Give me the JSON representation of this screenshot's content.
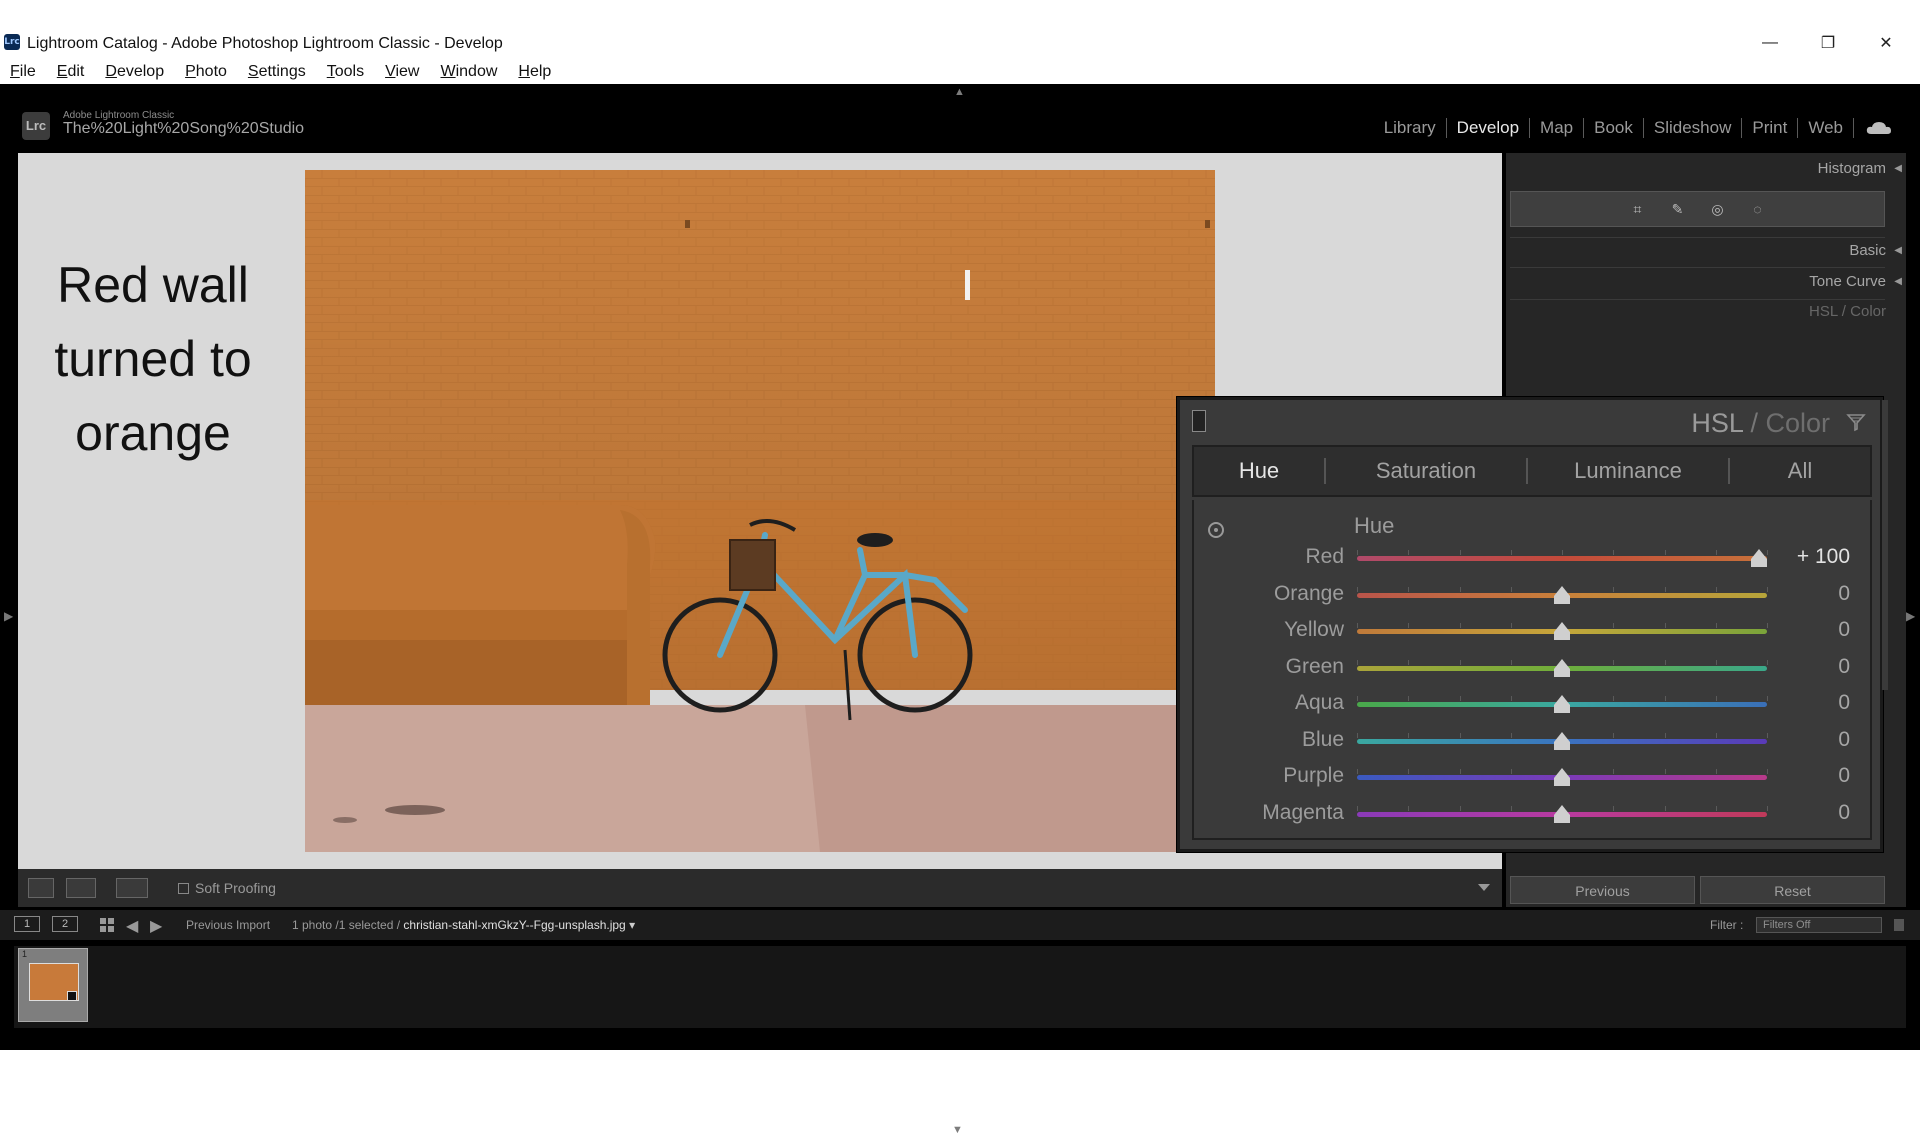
{
  "window": {
    "app_badge": "Lrc",
    "title": "Lightroom Catalog - Adobe Photoshop Lightroom Classic - Develop",
    "minimize": "—",
    "restore": "❐",
    "close": "✕"
  },
  "menubar": [
    {
      "label": "File",
      "accel": "F",
      "rest": "ile"
    },
    {
      "label": "Edit",
      "accel": "E",
      "rest": "dit"
    },
    {
      "label": "Develop",
      "accel": "D",
      "rest": "evelop"
    },
    {
      "label": "Photo",
      "accel": "P",
      "rest": "hoto"
    },
    {
      "label": "Settings",
      "accel": "S",
      "rest": "ettings"
    },
    {
      "label": "Tools",
      "accel": "T",
      "rest": "ools"
    },
    {
      "label": "View",
      "accel": "V",
      "rest": "iew"
    },
    {
      "label": "Window",
      "accel": "W",
      "rest": "indow"
    },
    {
      "label": "Help",
      "accel": "H",
      "rest": "elp"
    }
  ],
  "identity": {
    "logo": "Lrc",
    "app_name": "Adobe Lightroom Classic",
    "catalog": "The%20Light%20Song%20Studio"
  },
  "modules": {
    "items": [
      "Library",
      "Develop",
      "Map",
      "Book",
      "Slideshow",
      "Print",
      "Web"
    ],
    "active": "Develop"
  },
  "annotation": {
    "line1": "Red wall",
    "line2": "turned to",
    "line3": "orange"
  },
  "toolbar": {
    "soft_proofing": "Soft Proofing"
  },
  "right_panel": {
    "histogram": "Histogram",
    "basic": "Basic",
    "tone_curve": "Tone Curve",
    "hsl_partial": "HSL / Color",
    "previous": "Previous",
    "reset": "Reset"
  },
  "hsl": {
    "title_hsl": "HSL",
    "title_sep": " / ",
    "title_color": "Color",
    "tabs": [
      "Hue",
      "Saturation",
      "Luminance",
      "All"
    ],
    "active_tab": "Hue",
    "section": "Hue",
    "sliders": [
      {
        "name": "Red",
        "value_text": "+ 100",
        "value": 100,
        "colors": [
          "#b04a6a",
          "#c44a3a",
          "#c7713a"
        ]
      },
      {
        "name": "Orange",
        "value_text": "0",
        "value": 0,
        "colors": [
          "#b9544a",
          "#c9803a",
          "#b6a43a"
        ]
      },
      {
        "name": "Yellow",
        "value_text": "0",
        "value": 0,
        "colors": [
          "#c07a3a",
          "#c6a63a",
          "#7aa43a"
        ]
      },
      {
        "name": "Green",
        "value_text": "0",
        "value": 0,
        "colors": [
          "#aaa43a",
          "#6fae3a",
          "#3aa88a"
        ]
      },
      {
        "name": "Aqua",
        "value_text": "0",
        "value": 0,
        "colors": [
          "#4aa84a",
          "#3aa8a0",
          "#3a6fb8"
        ]
      },
      {
        "name": "Blue",
        "value_text": "0",
        "value": 0,
        "colors": [
          "#3aa8a0",
          "#3a74c0",
          "#5a3ab8"
        ]
      },
      {
        "name": "Purple",
        "value_text": "0",
        "value": 0,
        "colors": [
          "#3a5ac0",
          "#7a3ab8",
          "#b83a8a"
        ]
      },
      {
        "name": "Magenta",
        "value_text": "0",
        "value": 0,
        "colors": [
          "#8a3ab8",
          "#b83aa0",
          "#c03a5a"
        ]
      }
    ],
    "range": [
      -100,
      100
    ]
  },
  "filmstrip_header": {
    "screen1": "1",
    "screen2": "2",
    "source": "Previous Import",
    "count": "1 photo /1 selected /",
    "filename": "christian-stahl-xmGkzY--Fgg-unsplash.jpg",
    "filter_label": "Filter :",
    "filter_value": "Filters Off"
  },
  "filmstrip": {
    "thumb_index": "1"
  }
}
